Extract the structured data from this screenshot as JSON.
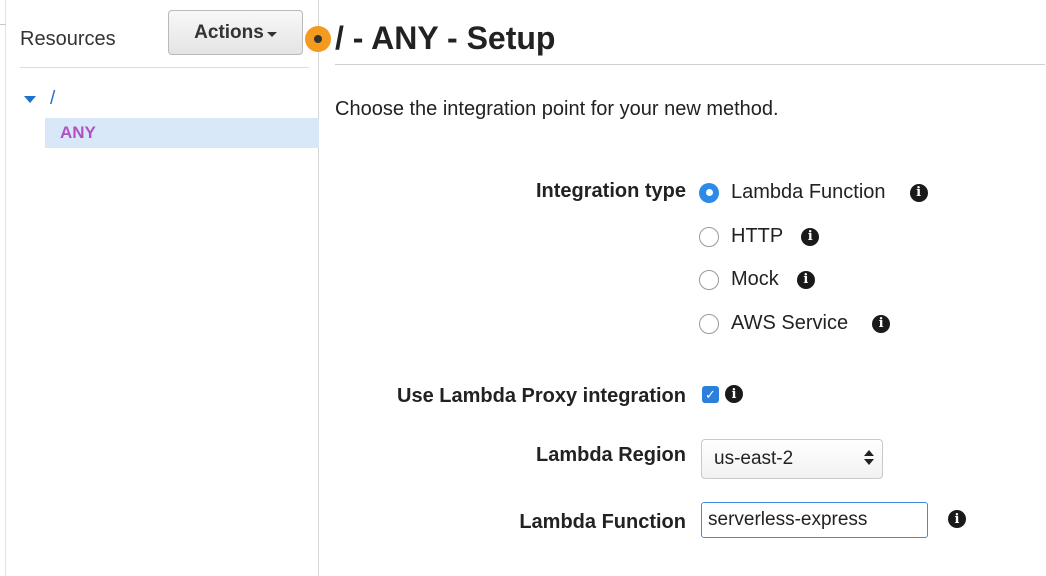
{
  "sidebar": {
    "title": "Resources",
    "actions_label": "Actions",
    "tree": {
      "root_label": "/",
      "selected_item": "ANY"
    }
  },
  "main": {
    "title": "/ - ANY - Setup",
    "intro": "Choose the integration point for your new method.",
    "integration_type": {
      "label": "Integration type",
      "options": [
        "Lambda Function",
        "HTTP",
        "Mock",
        "AWS Service"
      ],
      "selected": "Lambda Function"
    },
    "lambda_proxy": {
      "label": "Use Lambda Proxy integration",
      "checked": true
    },
    "lambda_region": {
      "label": "Lambda Region",
      "value": "us-east-2"
    },
    "lambda_function": {
      "label": "Lambda Function",
      "value": "serverless-express"
    }
  },
  "colors": {
    "accent": "#2c8ae8",
    "tree_link": "#1f6fcc",
    "method_label": "#b052c3",
    "selection_bg": "#d8e8f8",
    "handle": "#f49a1e"
  },
  "icons": {
    "info": "info-icon",
    "tree_toggle": "caret-down-icon",
    "actions_dropdown": "caret-down-icon",
    "select_arrows": "up-down-arrows-icon"
  }
}
